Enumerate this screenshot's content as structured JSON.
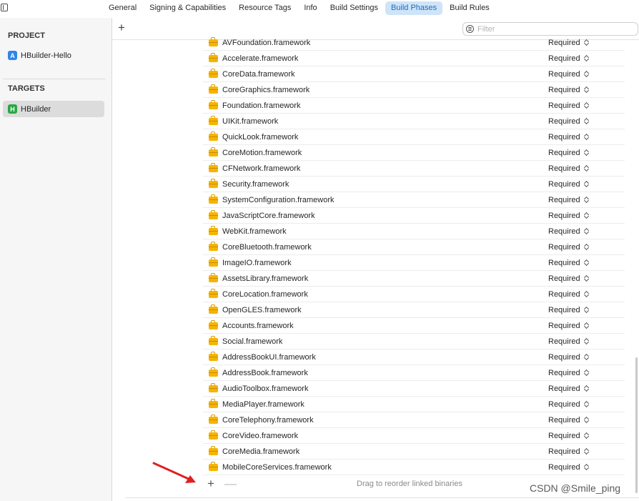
{
  "tabs": [
    {
      "label": "General"
    },
    {
      "label": "Signing & Capabilities"
    },
    {
      "label": "Resource Tags"
    },
    {
      "label": "Info"
    },
    {
      "label": "Build Settings"
    },
    {
      "label": "Build Phases",
      "active": true
    },
    {
      "label": "Build Rules"
    }
  ],
  "sidebar": {
    "project_title": "PROJECT",
    "project_item": "HBuilder-Hello",
    "targets_title": "TARGETS",
    "target_item": "HBuilder",
    "target_icon_letter": "H"
  },
  "toolbar": {
    "add_label": "+",
    "filter_placeholder": "Filter"
  },
  "frameworks": [
    {
      "name": "AVFoundation.framework",
      "status": "Required"
    },
    {
      "name": "Accelerate.framework",
      "status": "Required"
    },
    {
      "name": "CoreData.framework",
      "status": "Required"
    },
    {
      "name": "CoreGraphics.framework",
      "status": "Required"
    },
    {
      "name": "Foundation.framework",
      "status": "Required"
    },
    {
      "name": "UIKit.framework",
      "status": "Required"
    },
    {
      "name": "QuickLook.framework",
      "status": "Required"
    },
    {
      "name": "CoreMotion.framework",
      "status": "Required"
    },
    {
      "name": "CFNetwork.framework",
      "status": "Required"
    },
    {
      "name": "Security.framework",
      "status": "Required"
    },
    {
      "name": "SystemConfiguration.framework",
      "status": "Required"
    },
    {
      "name": "JavaScriptCore.framework",
      "status": "Required"
    },
    {
      "name": "WebKit.framework",
      "status": "Required"
    },
    {
      "name": "CoreBluetooth.framework",
      "status": "Required"
    },
    {
      "name": "ImageIO.framework",
      "status": "Required"
    },
    {
      "name": "AssetsLibrary.framework",
      "status": "Required"
    },
    {
      "name": "CoreLocation.framework",
      "status": "Required"
    },
    {
      "name": "OpenGLES.framework",
      "status": "Required"
    },
    {
      "name": "Accounts.framework",
      "status": "Required"
    },
    {
      "name": "Social.framework",
      "status": "Required"
    },
    {
      "name": "AddressBookUI.framework",
      "status": "Required"
    },
    {
      "name": "AddressBook.framework",
      "status": "Required"
    },
    {
      "name": "AudioToolbox.framework",
      "status": "Required"
    },
    {
      "name": "MediaPlayer.framework",
      "status": "Required"
    },
    {
      "name": "CoreTelephony.framework",
      "status": "Required"
    },
    {
      "name": "CoreVideo.framework",
      "status": "Required"
    },
    {
      "name": "CoreMedia.framework",
      "status": "Required"
    },
    {
      "name": "MobileCoreServices.framework",
      "status": "Required"
    }
  ],
  "footer": {
    "add_label": "+",
    "remove_label": "—",
    "hint": "Drag to reorder linked binaries"
  },
  "watermark": "CSDN @Smile_ping",
  "colors": {
    "accent": "#1a6dc2",
    "active_tab_bg": "#cfe4f8",
    "framework_icon": "#f5b400",
    "annotation_arrow": "#e02020"
  }
}
